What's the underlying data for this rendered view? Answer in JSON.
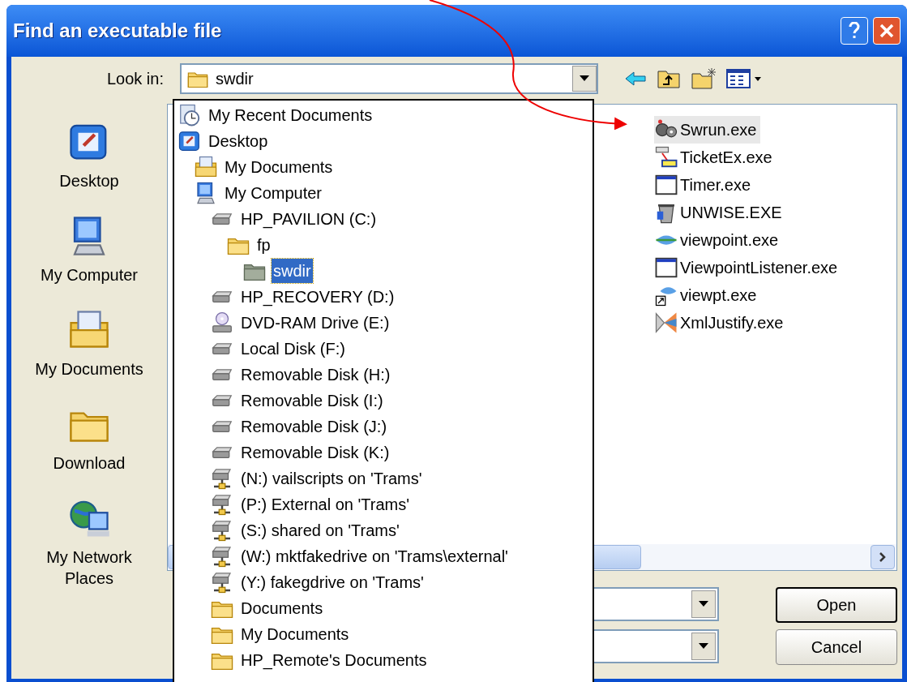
{
  "window": {
    "title": "Find an executable file"
  },
  "look_in": {
    "label": "Look in:",
    "value": "swdir"
  },
  "places": [
    {
      "label": "Desktop",
      "kind": "desktop"
    },
    {
      "label": "My Computer",
      "kind": "computer"
    },
    {
      "label": "My Documents",
      "kind": "mydocs"
    },
    {
      "label": "Download",
      "kind": "folder"
    },
    {
      "label": "My Network Places",
      "kind": "network"
    }
  ],
  "dropdown": {
    "items": [
      {
        "label": "My Recent Documents",
        "kind": "recent",
        "selected": false
      },
      {
        "label": "Desktop",
        "kind": "desktop",
        "selected": false,
        "children": [
          {
            "label": "My Documents",
            "kind": "mydocs",
            "selected": false
          },
          {
            "label": "My Computer",
            "kind": "computer",
            "selected": false,
            "children": [
              {
                "label": "HP_PAVILION (C:)",
                "kind": "drive",
                "selected": false,
                "children": [
                  {
                    "label": "fp",
                    "kind": "folder",
                    "selected": false,
                    "children": [
                      {
                        "label": "swdir",
                        "kind": "greyfolder",
                        "selected": true
                      }
                    ]
                  }
                ]
              },
              {
                "label": "HP_RECOVERY (D:)",
                "kind": "drive",
                "selected": false
              },
              {
                "label": "DVD-RAM Drive (E:)",
                "kind": "cdrom",
                "selected": false
              },
              {
                "label": "Local Disk (F:)",
                "kind": "drive",
                "selected": false
              },
              {
                "label": "Removable Disk (H:)",
                "kind": "drive",
                "selected": false
              },
              {
                "label": "Removable Disk (I:)",
                "kind": "drive",
                "selected": false
              },
              {
                "label": "Removable Disk (J:)",
                "kind": "drive",
                "selected": false
              },
              {
                "label": "Removable Disk (K:)",
                "kind": "drive",
                "selected": false
              },
              {
                "label": "(N:) vailscripts on 'Trams'",
                "kind": "netdrive",
                "selected": false
              },
              {
                "label": "(P:) External on 'Trams'",
                "kind": "netdrive",
                "selected": false
              },
              {
                "label": "(S:) shared on 'Trams'",
                "kind": "netdrive",
                "selected": false
              },
              {
                "label": "(W:) mktfakedrive on 'Trams\\external'",
                "kind": "netdrive",
                "selected": false
              },
              {
                "label": "(Y:) fakegdrive on 'Trams'",
                "kind": "netdrive",
                "selected": false
              },
              {
                "label": "Documents",
                "kind": "folder",
                "selected": false
              },
              {
                "label": "My Documents",
                "kind": "folder",
                "selected": false
              },
              {
                "label": "HP_Remote's Documents",
                "kind": "folder",
                "selected": false
              }
            ]
          }
        ]
      }
    ]
  },
  "files": [
    {
      "name": "Swrun.exe",
      "kind": "gear",
      "selected": true
    },
    {
      "name": "TicketEx.exe",
      "kind": "transfer",
      "selected": false
    },
    {
      "name": "Timer.exe",
      "kind": "window",
      "selected": false
    },
    {
      "name": "UNWISE.EXE",
      "kind": "bin",
      "selected": false
    },
    {
      "name": "viewpoint.exe",
      "kind": "wave",
      "selected": false
    },
    {
      "name": "ViewpointListener.exe",
      "kind": "window",
      "selected": false
    },
    {
      "name": "viewpt.exe",
      "kind": "shortcut",
      "selected": false
    },
    {
      "name": "XmlJustify.exe",
      "kind": "prism",
      "selected": false
    }
  ],
  "buttons": [
    {
      "label": "Open",
      "kind": "default"
    },
    {
      "label": "Cancel",
      "kind": "normal"
    }
  ]
}
